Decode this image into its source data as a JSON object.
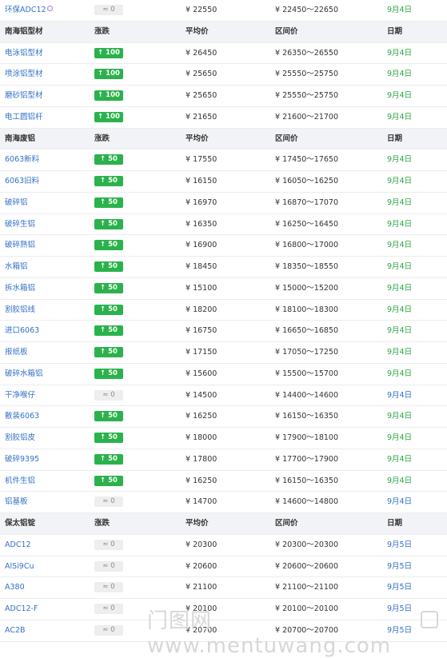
{
  "colors": {
    "up_badge": "#2bb24c",
    "flat_badge": "#eeeeee",
    "link": "#3471c7",
    "date_green": "#29a745",
    "header_bg": "#f1f3f6"
  },
  "rows": [
    {
      "type": "item",
      "name": "环保ADC12",
      "icon": "chip-icon",
      "change": "≈ 0",
      "kind": "flat",
      "avg": "¥ 22550",
      "range": "¥ 22450～22650",
      "date": "9月4日",
      "dc": "g"
    },
    {
      "type": "header",
      "name": "南海铝型材",
      "change": "涨跌",
      "avg": "平均价",
      "range": "区间价",
      "date": "日期"
    },
    {
      "type": "item",
      "name": "电泳铝型材",
      "change": "↑ 100",
      "kind": "up",
      "avg": "¥ 26450",
      "range": "¥ 26350～26550",
      "date": "9月4日",
      "dc": "g"
    },
    {
      "type": "item",
      "name": "喷涂铝型材",
      "change": "↑ 100",
      "kind": "up",
      "avg": "¥ 25650",
      "range": "¥ 25550～25750",
      "date": "9月4日",
      "dc": "g"
    },
    {
      "type": "item",
      "name": "磨砂铝型材",
      "change": "↑ 100",
      "kind": "up",
      "avg": "¥ 25650",
      "range": "¥ 25550～25750",
      "date": "9月4日",
      "dc": "g"
    },
    {
      "type": "item",
      "name": "电工圆铝杆",
      "change": "↑ 100",
      "kind": "up",
      "avg": "¥ 21650",
      "range": "¥ 21600～21700",
      "date": "9月4日",
      "dc": "g"
    },
    {
      "type": "header",
      "name": "南海废铝",
      "change": "涨跌",
      "avg": "平均价",
      "range": "区间价",
      "date": "日期"
    },
    {
      "type": "item",
      "name": "6063新料",
      "change": "↑ 50",
      "kind": "up",
      "avg": "¥ 17550",
      "range": "¥ 17450～17650",
      "date": "9月4日",
      "dc": "g"
    },
    {
      "type": "item",
      "name": "6063旧料",
      "change": "↑ 50",
      "kind": "up",
      "avg": "¥ 16150",
      "range": "¥ 16050～16250",
      "date": "9月4日",
      "dc": "g"
    },
    {
      "type": "item",
      "name": "破碎铝",
      "change": "↑ 50",
      "kind": "up",
      "avg": "¥ 16970",
      "range": "¥ 16870～17070",
      "date": "9月4日",
      "dc": "g"
    },
    {
      "type": "item",
      "name": "破碎生铝",
      "change": "↑ 50",
      "kind": "up",
      "avg": "¥ 16350",
      "range": "¥ 16250～16450",
      "date": "9月4日",
      "dc": "g"
    },
    {
      "type": "item",
      "name": "破碎熟铝",
      "change": "↑ 50",
      "kind": "up",
      "avg": "¥ 16900",
      "range": "¥ 16800～17000",
      "date": "9月4日",
      "dc": "g"
    },
    {
      "type": "item",
      "name": "水箱铝",
      "change": "↑ 50",
      "kind": "up",
      "avg": "¥ 18450",
      "range": "¥ 18350～18550",
      "date": "9月4日",
      "dc": "g"
    },
    {
      "type": "item",
      "name": "拆水箱铝",
      "change": "↑ 50",
      "kind": "up",
      "avg": "¥ 15100",
      "range": "¥ 15000～15200",
      "date": "9月4日",
      "dc": "g"
    },
    {
      "type": "item",
      "name": "割胶铝线",
      "change": "↑ 50",
      "kind": "up",
      "avg": "¥ 18200",
      "range": "¥ 18100～18300",
      "date": "9月4日",
      "dc": "g"
    },
    {
      "type": "item",
      "name": "进口6063",
      "change": "↑ 50",
      "kind": "up",
      "avg": "¥ 16750",
      "range": "¥ 16650～16850",
      "date": "9月4日",
      "dc": "g"
    },
    {
      "type": "item",
      "name": "报纸板",
      "change": "↑ 50",
      "kind": "up",
      "avg": "¥ 17150",
      "range": "¥ 17050～17250",
      "date": "9月4日",
      "dc": "g"
    },
    {
      "type": "item",
      "name": "破碎水箱铝",
      "change": "↑ 50",
      "kind": "up",
      "avg": "¥ 15600",
      "range": "¥ 15500～15700",
      "date": "9月4日",
      "dc": "g"
    },
    {
      "type": "item",
      "name": "干净喉仔",
      "change": "≈ 0",
      "kind": "flat",
      "avg": "¥ 14500",
      "range": "¥ 14400～14600",
      "date": "9月4日",
      "dc": "b"
    },
    {
      "type": "item",
      "name": "散装6063",
      "change": "↑ 50",
      "kind": "up",
      "avg": "¥ 16250",
      "range": "¥ 16150～16350",
      "date": "9月4日",
      "dc": "g"
    },
    {
      "type": "item",
      "name": "割胶铝皮",
      "change": "↑ 50",
      "kind": "up",
      "avg": "¥ 18000",
      "range": "¥ 17900～18100",
      "date": "9月4日",
      "dc": "g"
    },
    {
      "type": "item",
      "name": "破碎9395",
      "change": "↑ 50",
      "kind": "up",
      "avg": "¥ 17800",
      "range": "¥ 17700～17900",
      "date": "9月4日",
      "dc": "g"
    },
    {
      "type": "item",
      "name": "机件生铝",
      "change": "↑ 50",
      "kind": "up",
      "avg": "¥ 16250",
      "range": "¥ 16150～16350",
      "date": "9月4日",
      "dc": "g"
    },
    {
      "type": "item",
      "name": "铝基板",
      "change": "≈ 0",
      "kind": "flat",
      "avg": "¥ 14700",
      "range": "¥ 14600～14800",
      "date": "9月4日",
      "dc": "b"
    },
    {
      "type": "header",
      "name": "保太铝锭",
      "change": "涨跌",
      "avg": "平均价",
      "range": "区间价",
      "date": "日期"
    },
    {
      "type": "item",
      "name": "ADC12",
      "change": "≈ 0",
      "kind": "flat",
      "avg": "¥ 20300",
      "range": "¥ 20300～20300",
      "date": "9月5日",
      "dc": "b"
    },
    {
      "type": "item",
      "name": "AlSi9Cu",
      "change": "≈ 0",
      "kind": "flat",
      "avg": "¥ 20600",
      "range": "¥ 20600～20600",
      "date": "9月5日",
      "dc": "b"
    },
    {
      "type": "item",
      "name": "A380",
      "change": "≈ 0",
      "kind": "flat",
      "avg": "¥ 21100",
      "range": "¥ 21100～21100",
      "date": "9月5日",
      "dc": "b"
    },
    {
      "type": "item",
      "name": "ADC12-F",
      "change": "≈ 0",
      "kind": "flat",
      "avg": "¥ 20100",
      "range": "¥ 20100～20100",
      "date": "9月5日",
      "dc": "b"
    },
    {
      "type": "item",
      "name": "AC2B",
      "change": "≈ 0",
      "kind": "flat",
      "avg": "¥ 20700",
      "range": "¥ 20700～20700",
      "date": "9月5日",
      "dc": "b"
    }
  ],
  "watermark": {
    "text": "门图网 www.mentuwang.com",
    "icon": "mentuwang-logo-icon"
  }
}
